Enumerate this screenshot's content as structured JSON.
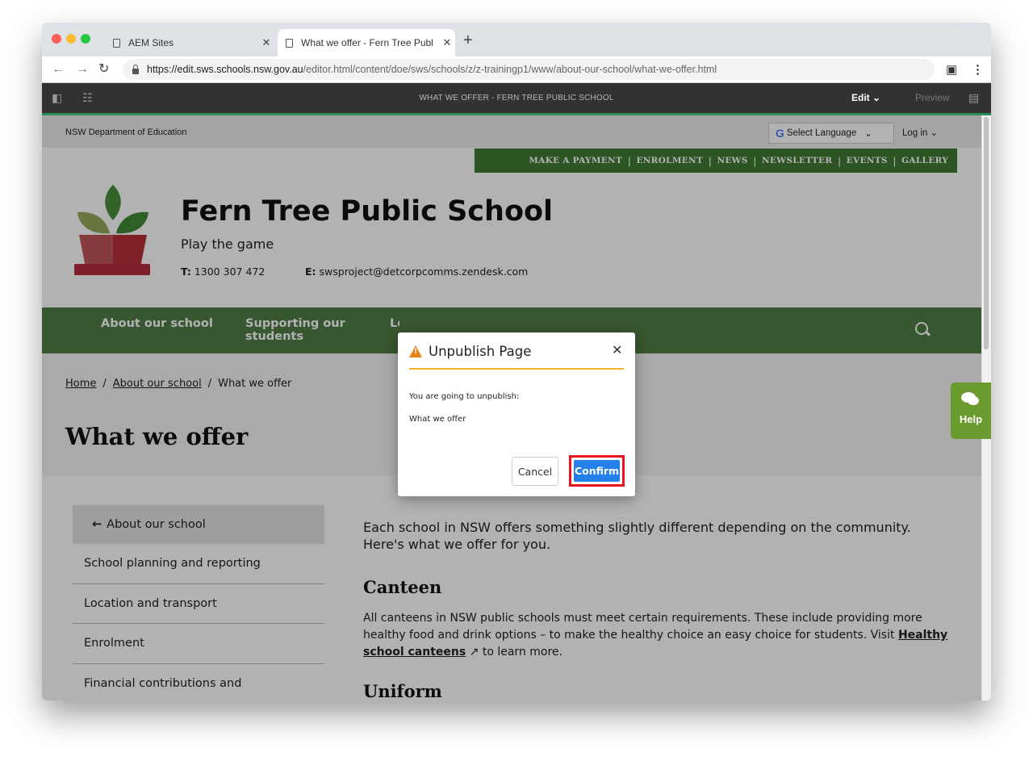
{
  "browser": {
    "tabs": [
      {
        "title": "AEM Sites"
      },
      {
        "title": "What we offer - Fern Tree Publ"
      }
    ],
    "url_domain": "https://edit.sws.schools.nsw.gov.au",
    "url_path": "/editor.html/content/doe/sws/schools/z/z-trainingp1/www/about-our-school/what-we-offer.html"
  },
  "aem": {
    "page_title": "WHAT WE OFFER - FERN TREE PUBLIC SCHOOL",
    "edit_label": "Edit",
    "preview_label": "Preview"
  },
  "site": {
    "department": "NSW Department of Education",
    "language_label": "Select Language",
    "login_label": "Log in",
    "quicklinks": [
      "MAKE A PAYMENT",
      "ENROLMENT",
      "NEWS",
      "NEWSLETTER",
      "EVENTS",
      "GALLERY"
    ],
    "school_name": "Fern Tree Public School",
    "motto": "Play the game",
    "phone_label": "T:",
    "phone": "1300 307 472",
    "email_label": "E:",
    "email": "swsproject@detcorpcomms.zendesk.com",
    "nav": [
      "About our school",
      "Supporting our students",
      "Le... st..."
    ],
    "breadcrumb": [
      "Home",
      "About our school",
      "What we offer"
    ],
    "page_heading": "What we offer",
    "sidenav_back": "About our school",
    "sidenav": [
      "School planning and reporting",
      "Location and transport",
      "Enrolment",
      "Financial contributions and"
    ],
    "intro": "Each school in NSW offers something slightly different depending on the community. Here's what we offer for you.",
    "canteen_heading": "Canteen",
    "canteen_text": "All canteens in NSW public schools must meet certain requirements. These include providing more healthy food and drink options – to make the healthy choice an easy choice for students. Visit",
    "canteen_link": "Healthy school canteens",
    "canteen_tail": "to learn more.",
    "next_heading": "Uniform",
    "help_label": "Help"
  },
  "dialog": {
    "title": "Unpublish Page",
    "message": "You are going to unpublish:",
    "page": "What we offer",
    "cancel": "Cancel",
    "confirm": "Confirm"
  },
  "colors": {
    "green_nav": "#4f7d45",
    "quicklinks_bg": "#3f7a33",
    "confirm_blue": "#2680eb",
    "highlight_red": "#e8141c",
    "warning": "#e68619"
  }
}
